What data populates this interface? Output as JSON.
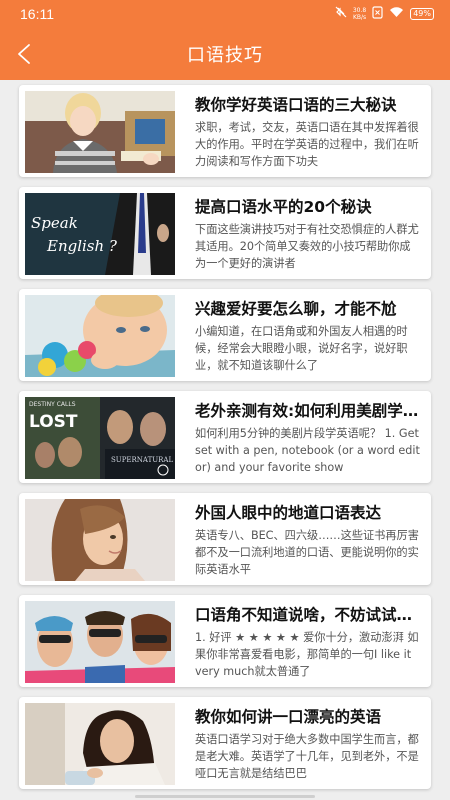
{
  "status_bar": {
    "time": "16:11",
    "speed_value": "30.8",
    "speed_unit": "KB/s",
    "battery": "49%"
  },
  "app_bar": {
    "title": "口语技巧",
    "back_icon": "chevron-left-icon"
  },
  "colors": {
    "accent": "#f47c3c",
    "background": "#eeeeee"
  },
  "articles": [
    {
      "title": "教你学好英语口语的三大秘诀",
      "summary": "求职，考试，交友，英语口语在其中发挥着很大的作用。平时在学英语的过程中，我们在听力阅读和写作方面下功夫",
      "thumb_text": ""
    },
    {
      "title": "提高口语水平的20个秘诀",
      "summary": "下面这些演讲技巧对于有社交恐惧症的人群尤其适用。20个简单又奏效的小技巧帮助你成为一个更好的演讲者",
      "thumb_text": "Speak English ?"
    },
    {
      "title": "兴趣爱好要怎么聊，才能不尬",
      "summary": "小编知道，在口语角或和外国友人相遇的时候，经常会大眼瞪小眼，说好名字，说好职业，就不知道该聊什么了",
      "thumb_text": ""
    },
    {
      "title": "老外亲测有效:如何利用美剧学英语",
      "summary": "如何利用5分钟的美剧片段学英语呢？ 1. Get set with a pen, notebook (or a word editor) and your favorite show",
      "thumb_text": "LOST",
      "thumb_caption": "SUPERNATURAL",
      "thumb_header": "DESTINY CALLS"
    },
    {
      "title": "外国人眼中的地道口语表达",
      "summary": "英语专八、BEC、四六级……这些证书再厉害都不及一口流利地道的口语、更能说明你的实际英语水平",
      "thumb_text": ""
    },
    {
      "title": "口语角不知道说啥，不妨试试这些",
      "summary": "1. 好评 ★ ★ ★ ★ ★ 爱你十分，激动澎湃 如果你非常喜爱看电影，那简单的一句I like it very much就太普通了",
      "thumb_text": ""
    },
    {
      "title": "教你如何讲一口漂亮的英语",
      "summary": "英语口语学习对于绝大多数中国学生而言，都是老大难。英语学了十几年，见到老外，不是哑口无言就是结结巴巴",
      "thumb_text": ""
    }
  ]
}
